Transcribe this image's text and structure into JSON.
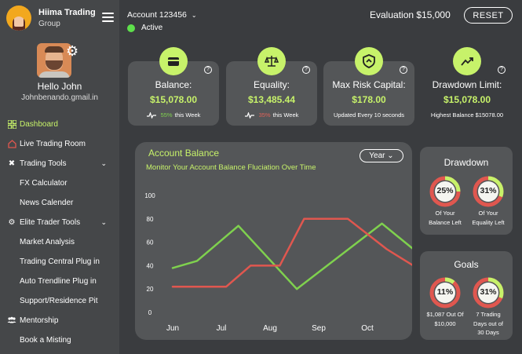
{
  "brand": {
    "name": "Hiima Trading",
    "subtitle": "Group"
  },
  "user": {
    "greeting": "Hello John",
    "email": "Johnbenando.gmail.in"
  },
  "menu": [
    {
      "label": "Dashboard",
      "icon": "dashboard-icon",
      "active": true
    },
    {
      "label": "Live Trading Room",
      "icon": "home-icon"
    },
    {
      "label": "Trading Tools",
      "icon": "tools-icon",
      "expandable": true
    },
    {
      "label": "FX Calculator",
      "sub": true
    },
    {
      "label": "News Calender",
      "sub": true
    },
    {
      "label": "Elite Trader Tools",
      "icon": "star-icon",
      "expandable": true
    },
    {
      "label": "Market Analysis",
      "sub": true
    },
    {
      "label": "Trading Central Plug in",
      "sub": true
    },
    {
      "label": "Auto Trendline Plug in",
      "sub": true
    },
    {
      "label": "Support/Residence Pit",
      "sub": true
    },
    {
      "label": "Mentorship",
      "icon": "people-icon"
    },
    {
      "label": "Book a Misting",
      "sub": true
    }
  ],
  "topbar": {
    "account": "Account 123456",
    "status": "Active",
    "evaluation": "Evaluation $15,000",
    "reset_label": "RESET"
  },
  "cards": [
    {
      "label": "Balance:",
      "value": "$15,078.00",
      "pct": "55%",
      "pct_suffix": "this Week",
      "trend": "up"
    },
    {
      "label": "Equality:",
      "value": "$13,485.44",
      "pct": "35%",
      "pct_suffix": "this Week",
      "trend": "down"
    },
    {
      "label": "Max Risk Capital:",
      "value": "$178.00",
      "foot": "Updated Every 10 seconds"
    },
    {
      "label": "Drawdown Limit:",
      "value": "$15,078.00",
      "foot": "Highest Balance $15078.00"
    }
  ],
  "chart_panel": {
    "title": "Account Balance",
    "subtitle": "Monitor Your Account Balance Fluciation Over Time",
    "period": "Year"
  },
  "chart_data": {
    "type": "line",
    "categories": [
      "Jun",
      "Jul",
      "Aug",
      "Sep",
      "Oct"
    ],
    "ylim": [
      0,
      100
    ],
    "yticks": [
      0,
      20,
      40,
      60,
      80,
      100
    ],
    "series": [
      {
        "color": "#7fd14e",
        "points": [
          [
            0,
            38
          ],
          [
            0.5,
            44
          ],
          [
            1.35,
            74
          ],
          [
            2.55,
            20
          ],
          [
            4.3,
            76
          ],
          [
            5.3,
            42
          ]
        ]
      },
      {
        "color": "#e0574f",
        "points": [
          [
            0,
            22
          ],
          [
            1.1,
            22
          ],
          [
            1.6,
            40
          ],
          [
            2.2,
            40
          ],
          [
            2.7,
            80
          ],
          [
            3.6,
            80
          ],
          [
            4.4,
            54
          ],
          [
            5.1,
            36
          ],
          [
            5.2,
            86
          ],
          [
            5.35,
            86
          ]
        ]
      }
    ]
  },
  "drawdown": {
    "title": "Drawdown",
    "items": [
      {
        "pct": "25%",
        "value": 25,
        "caption": [
          "Of Your",
          "Balance Left"
        ]
      },
      {
        "pct": "31%",
        "value": 31,
        "caption": [
          "Of Your",
          "Equality Left"
        ]
      }
    ]
  },
  "goals": {
    "title": "Goals",
    "items": [
      {
        "pct": "11%",
        "value": 11,
        "caption": [
          "$1,087 Out Of",
          "$10,000"
        ]
      },
      {
        "pct": "31%",
        "value": 31,
        "caption": [
          "7 Trading",
          "Days out of",
          "30 Days"
        ]
      }
    ]
  },
  "colors": {
    "accent": "#c7f26a",
    "green": "#7fd14e",
    "red": "#e0574f",
    "panel": "#545658",
    "sidebar": "#454749"
  }
}
